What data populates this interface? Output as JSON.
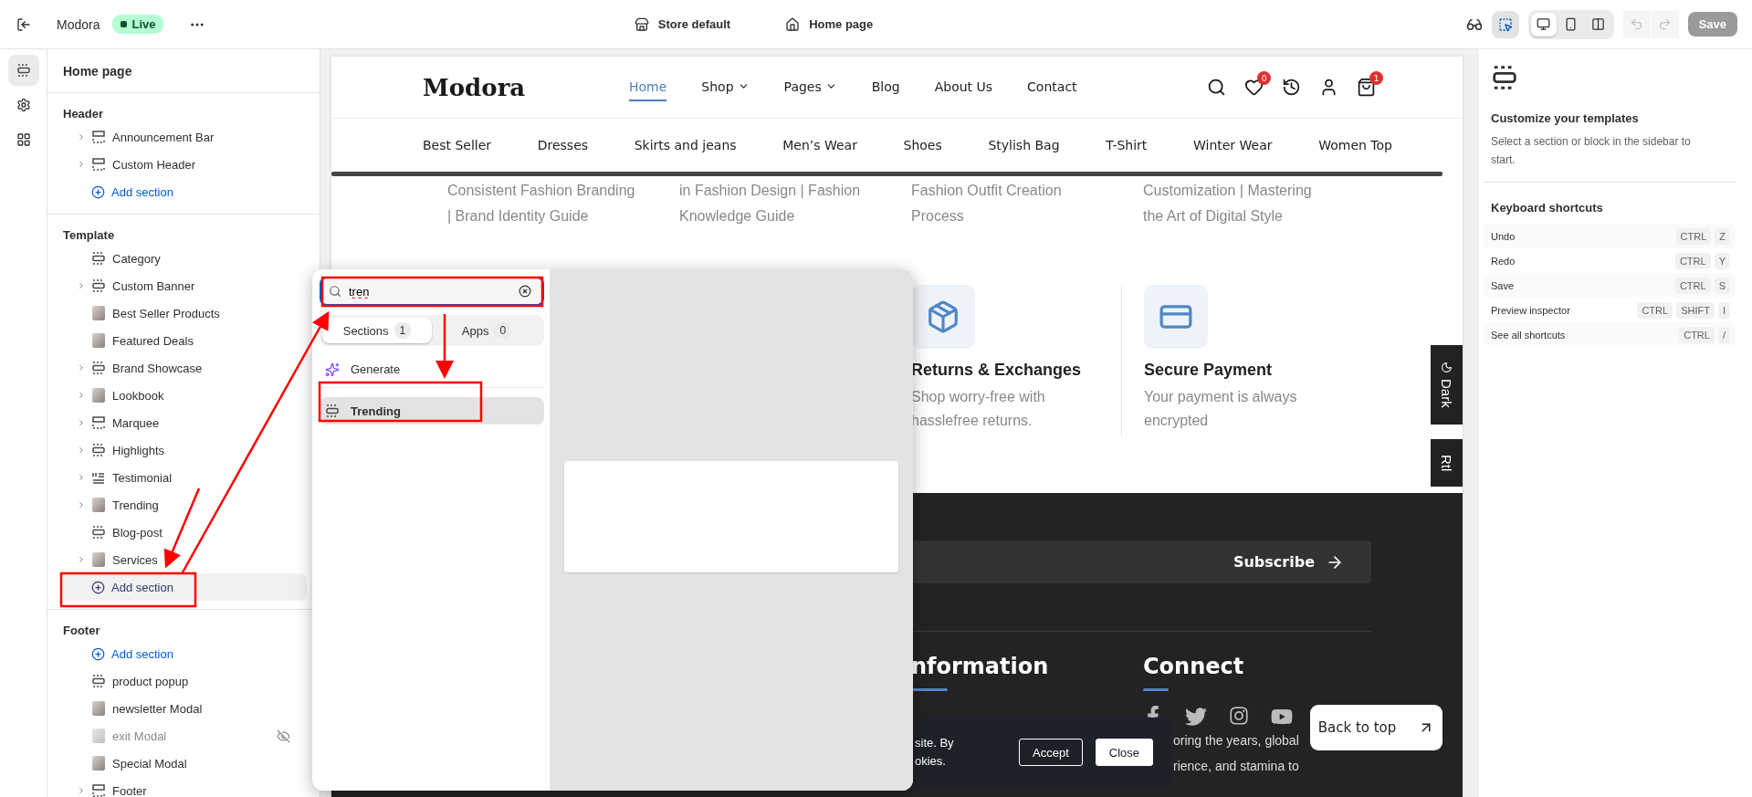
{
  "topbar": {
    "store_name": "Modora",
    "status": "Live",
    "template": "Store default",
    "page": "Home page",
    "inspector_selected": true,
    "view_modes": [
      {
        "kind": "desktop",
        "selected": true
      },
      {
        "kind": "mobile",
        "selected": false
      },
      {
        "kind": "fullwidth",
        "selected": false
      }
    ],
    "history": [
      {
        "kind": "undo",
        "disabled": true
      },
      {
        "kind": "redo",
        "disabled": true
      }
    ],
    "save": {
      "label": "Save",
      "disabled": true
    }
  },
  "rail": [
    {
      "kind": "sections",
      "selected": true
    },
    {
      "kind": "settings",
      "selected": false
    },
    {
      "kind": "apps",
      "selected": false
    }
  ],
  "sidebar": {
    "title": "Home page",
    "groups": [
      {
        "title": "Header",
        "entries": [
          {
            "kind": "header_section",
            "label": "Announcement Bar",
            "expandable": true,
            "hidden": false
          },
          {
            "kind": "header_section",
            "label": "Custom Header",
            "expandable": true,
            "hidden": false
          },
          {
            "kind": "add",
            "label": "Add section",
            "selected": false
          }
        ]
      },
      {
        "title": "Template",
        "entries": [
          {
            "kind": "section",
            "label": "Category",
            "expandable": false,
            "hidden": false
          },
          {
            "kind": "section",
            "label": "Custom Banner",
            "expandable": true,
            "hidden": false
          },
          {
            "kind": "photo_section",
            "label": "Best Seller Products",
            "expandable": false,
            "hidden": false
          },
          {
            "kind": "photo_section",
            "label": "Featured Deals",
            "expandable": false,
            "hidden": false
          },
          {
            "kind": "section",
            "label": "Brand Showcase",
            "expandable": true,
            "hidden": false
          },
          {
            "kind": "photo_section",
            "label": "Lookbook",
            "expandable": true,
            "hidden": false
          },
          {
            "kind": "header_section",
            "label": "Marquee",
            "expandable": true,
            "hidden": false
          },
          {
            "kind": "section",
            "label": "Highlights",
            "expandable": true,
            "hidden": false
          },
          {
            "kind": "quote_section",
            "label": "Testimonial",
            "expandable": true,
            "hidden": false
          },
          {
            "kind": "photo_section",
            "label": "Trending",
            "expandable": true,
            "hidden": false
          },
          {
            "kind": "section",
            "label": "Blog-post",
            "expandable": false,
            "hidden": false
          },
          {
            "kind": "photo_section",
            "label": "Services",
            "expandable": true,
            "hidden": false
          },
          {
            "kind": "add",
            "label": "Add section",
            "selected": true
          }
        ]
      },
      {
        "title": "Footer",
        "entries": [
          {
            "kind": "add",
            "label": "Add section",
            "selected": false
          },
          {
            "kind": "section",
            "label": "product popup",
            "expandable": false,
            "hidden": false
          },
          {
            "kind": "photo_section",
            "label": "newsletter Modal",
            "expandable": false,
            "hidden": false
          },
          {
            "kind": "photo_section",
            "label": "exit Modal",
            "expandable": false,
            "hidden": true
          },
          {
            "kind": "photo_section",
            "label": "Special Modal",
            "expandable": false,
            "hidden": false
          },
          {
            "kind": "header_section",
            "label": "Footer",
            "expandable": true,
            "hidden": false
          }
        ]
      }
    ]
  },
  "store": {
    "logo": "Modora",
    "nav": [
      {
        "label": "Home",
        "selected": true,
        "dropdown": false
      },
      {
        "label": "Shop",
        "selected": false,
        "dropdown": true
      },
      {
        "label": "Pages",
        "selected": false,
        "dropdown": true
      },
      {
        "label": "Blog",
        "selected": false,
        "dropdown": false
      },
      {
        "label": "About Us",
        "selected": false,
        "dropdown": false
      },
      {
        "label": "Contact",
        "selected": false,
        "dropdown": false
      }
    ],
    "actions": [
      {
        "kind": "search"
      },
      {
        "kind": "wishlist",
        "badge": "0"
      },
      {
        "kind": "history"
      },
      {
        "kind": "account"
      },
      {
        "kind": "cart",
        "badge": "1"
      }
    ],
    "categories": [
      "Best Seller",
      "Dresses",
      "Skirts and jeans",
      "Men’s Wear",
      "Shoes",
      "Stylish Bag",
      "T-Shirt",
      "Winter Wear",
      "Women Top"
    ],
    "blog_snippets": [
      [
        "Consistent Fashion Branding",
        "| Brand Identity Guide"
      ],
      [
        "in Fashion Design | Fashion",
        "Knowledge Guide"
      ],
      [
        "Fashion Outfit Creation",
        "Process"
      ],
      [
        "Customization | Mastering",
        "the Art of Digital Style"
      ]
    ],
    "features": [
      {
        "kind": "returns",
        "title": "Returns & Exchanges",
        "lines": [
          "Shop worry-free with",
          "hasslefree returns."
        ]
      },
      {
        "kind": "payment",
        "title": "Secure Payment",
        "lines": [
          "Your payment is always",
          "encrypted"
        ]
      }
    ],
    "footer": {
      "subscribe": "Subscribe",
      "headings": [
        "nformation",
        "Connect"
      ],
      "about_lines": [
        "oring the years, global",
        "rience, and stamina to"
      ]
    },
    "cookie": {
      "lines": [
        "site. By",
        "okies."
      ],
      "buttons": [
        {
          "label": "Accept",
          "kind": "outline"
        },
        {
          "label": "Close",
          "kind": "solid"
        }
      ]
    },
    "back_to_top": "Back to top",
    "side_tabs": [
      {
        "label": "Dark",
        "kind": "theme"
      },
      {
        "label": "Rtl",
        "kind": "direction"
      }
    ]
  },
  "picker": {
    "search_value": "tren",
    "tabs": [
      {
        "label": "Sections",
        "count": "1",
        "selected": true
      },
      {
        "label": "Apps",
        "count": "0",
        "selected": false
      }
    ],
    "generate": "Generate",
    "results": [
      {
        "label": "Trending",
        "selected": true
      }
    ]
  },
  "inspector": {
    "title": "Customize your templates",
    "description": "Select a section or block in the sidebar to start.",
    "shortcuts_title": "Keyboard shortcuts",
    "shortcuts": [
      {
        "label": "Undo",
        "keys": [
          "CTRL",
          "Z"
        ]
      },
      {
        "label": "Redo",
        "keys": [
          "CTRL",
          "Y"
        ]
      },
      {
        "label": "Save",
        "keys": [
          "CTRL",
          "S"
        ]
      },
      {
        "label": "Preview inspector",
        "keys": [
          "CTRL",
          "SHIFT",
          "I"
        ]
      },
      {
        "label": "See all shortcuts",
        "keys": [
          "CTRL",
          "/"
        ]
      }
    ]
  }
}
